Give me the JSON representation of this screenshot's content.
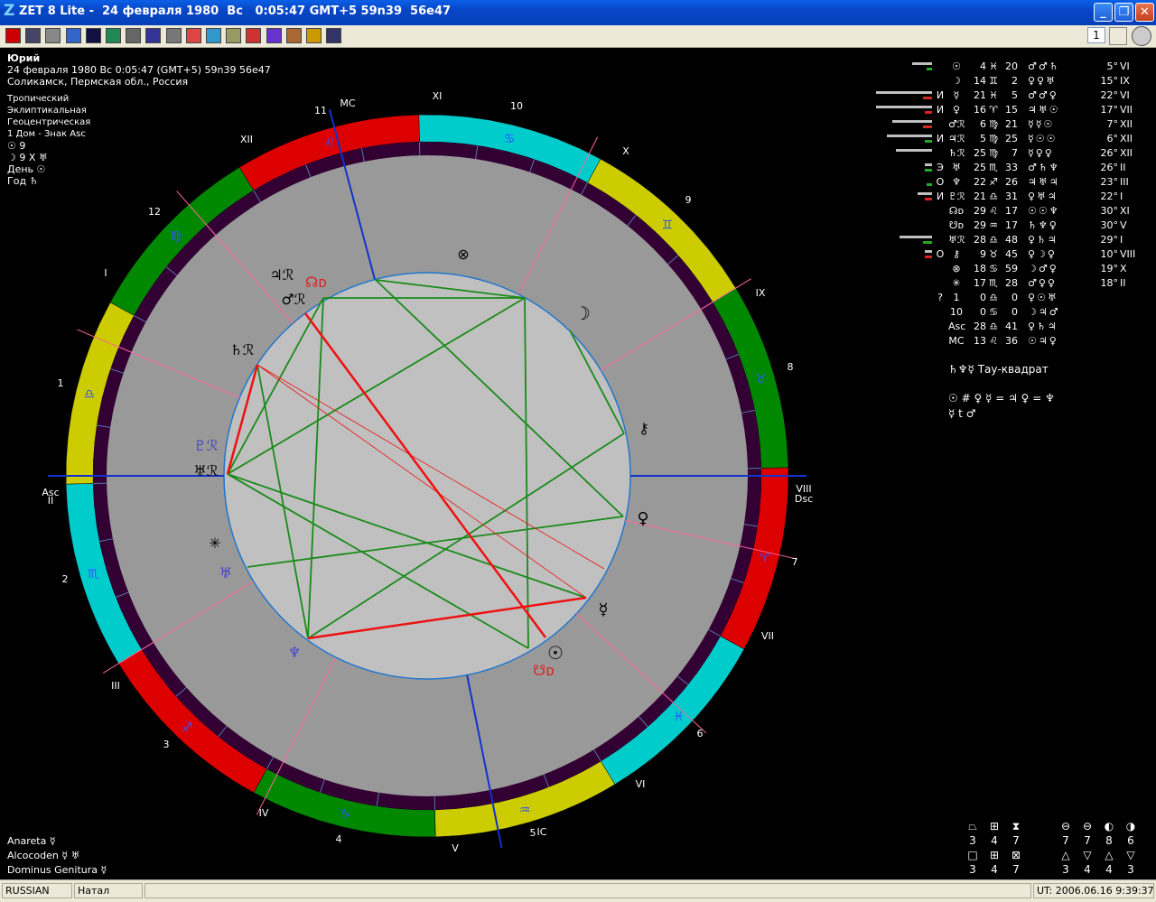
{
  "window": {
    "logo": "Z",
    "title": "ZET 8 Lite -  24 февраля 1980  Вс   0:05:47 GMT+5 59n39  56e47",
    "minimize": "_",
    "maximize": "❐",
    "close": "✕"
  },
  "toolbar": {
    "icons": [
      "sun-icon",
      "table-icon",
      "globe-icon",
      "wheel-icon",
      "star-map-icon",
      "grid-icon",
      "document-icon",
      "bookmark-icon",
      "page-icon",
      "color-grid-icon",
      "edit-icon",
      "notes-icon",
      "chart-icon",
      "wheel2-icon",
      "tools-icon",
      "person-icon",
      "graph-icon"
    ],
    "counter": "1"
  },
  "info": {
    "person": "Юрий",
    "date": "24 февраля 1980  Вс   0:05:47 (GMT+5) 59n39  56e47",
    "place": "Соликамск, Пермская обл., Россия",
    "zodiac": "Тропический",
    "coords": "Эклиптикальная",
    "center": "Геоцентрическая",
    "houses": "1 Дом - Знак Asc",
    "sun_line": "☉   9",
    "moon_line": "☽   9 X ♅",
    "day_line": "День ☉",
    "year_line": "Год ♄"
  },
  "positions": [
    {
      "flag": "",
      "glyph": "☉",
      "deg": "4",
      "sign": "♓",
      "min": "20",
      "rulers": "♂♂♄",
      "hdeg": "5°",
      "house": "VI",
      "gbar": 22,
      "cbar": 6,
      "ccol": "#22aa22"
    },
    {
      "flag": "",
      "glyph": "☽",
      "deg": "14",
      "sign": "♊",
      "min": "2",
      "rulers": "♀♀♅",
      "hdeg": "15°",
      "house": "IX",
      "gbar": 0,
      "cbar": 0,
      "ccol": "#22aa22"
    },
    {
      "flag": "И",
      "glyph": "☿",
      "deg": "21",
      "sign": "♓",
      "min": "5",
      "rulers": "♂♂♀",
      "hdeg": "22°",
      "house": "VI",
      "gbar": 62,
      "cbar": 10,
      "ccol": "#dd2222"
    },
    {
      "flag": "И",
      "glyph": "♀",
      "deg": "16",
      "sign": "♈",
      "min": "15",
      "rulers": "♃♅☉",
      "hdeg": "17°",
      "house": "VII",
      "gbar": 62,
      "cbar": 8,
      "ccol": "#dd2222"
    },
    {
      "flag": "",
      "glyph": "♂ℛ",
      "deg": "6",
      "sign": "♍",
      "min": "21",
      "rulers": "☿☿☉",
      "hdeg": "7°",
      "house": "XII",
      "gbar": 44,
      "cbar": 10,
      "ccol": "#dd2222"
    },
    {
      "flag": "И",
      "glyph": "♃ℛ",
      "deg": "5",
      "sign": "♍",
      "min": "25",
      "rulers": "☿☉☉",
      "hdeg": "6°",
      "house": "XII",
      "gbar": 50,
      "cbar": 8,
      "ccol": "#22aa22"
    },
    {
      "flag": "",
      "glyph": "♄ℛ",
      "deg": "25",
      "sign": "♍",
      "min": "7",
      "rulers": "☿♀♀",
      "hdeg": "26°",
      "house": "XII",
      "gbar": 40,
      "cbar": 0,
      "ccol": "#22aa22"
    },
    {
      "flag": "Э",
      "glyph": "♅",
      "deg": "25",
      "sign": "♏",
      "min": "33",
      "rulers": "♂♄♆",
      "hdeg": "26°",
      "house": "II",
      "gbar": 8,
      "cbar": 8,
      "ccol": "#22aa22"
    },
    {
      "flag": "О",
      "glyph": "♆",
      "deg": "22",
      "sign": "♐",
      "min": "26",
      "rulers": "♃♅♃",
      "hdeg": "23°",
      "house": "III",
      "gbar": 0,
      "cbar": 6,
      "ccol": "#22aa22"
    },
    {
      "flag": "И",
      "glyph": "♇ℛ",
      "deg": "21",
      "sign": "♎",
      "min": "31",
      "rulers": "♀♅♃",
      "hdeg": "22°",
      "house": "I",
      "gbar": 16,
      "cbar": 8,
      "ccol": "#dd2222"
    },
    {
      "flag": "",
      "glyph": "☊ᴅ",
      "deg": "29",
      "sign": "♌",
      "min": "17",
      "rulers": "☉☉♆",
      "hdeg": "30°",
      "house": "XI",
      "gbar": 0,
      "cbar": 0,
      "ccol": "#22aa22"
    },
    {
      "flag": "",
      "glyph": "☋ᴅ",
      "deg": "29",
      "sign": "♒",
      "min": "17",
      "rulers": "♄♆♀",
      "hdeg": "30°",
      "house": "V",
      "gbar": 0,
      "cbar": 0,
      "ccol": "#22aa22"
    },
    {
      "flag": "",
      "glyph": "♅ℛ",
      "deg": "28",
      "sign": "♎",
      "min": "48",
      "rulers": "♀♄♃",
      "hdeg": "29°",
      "house": "I",
      "gbar": 36,
      "cbar": 10,
      "ccol": "#22aa22"
    },
    {
      "flag": "О",
      "glyph": "⚷",
      "deg": "9",
      "sign": "♉",
      "min": "45",
      "rulers": "♀☽♀",
      "hdeg": "10°",
      "house": "VIII",
      "gbar": 8,
      "cbar": 8,
      "ccol": "#dd2222"
    },
    {
      "flag": "",
      "glyph": "⊗",
      "deg": "18",
      "sign": "♋",
      "min": "59",
      "rulers": "☽♂♀",
      "hdeg": "19°",
      "house": "X",
      "gbar": 0,
      "cbar": 0,
      "ccol": "#22aa22"
    },
    {
      "flag": "",
      "glyph": "✳",
      "deg": "17",
      "sign": "♏",
      "min": "28",
      "rulers": "♂♀♀",
      "hdeg": "18°",
      "house": "II",
      "gbar": 0,
      "cbar": 0,
      "ccol": "#22aa22"
    },
    {
      "flag": "?",
      "glyph": "1",
      "deg": "0",
      "sign": "♎",
      "min": "0",
      "rulers": "♀☉♅",
      "hdeg": "",
      "house": "",
      "gbar": 0,
      "cbar": 0,
      "ccol": "#22aa22"
    },
    {
      "flag": "",
      "glyph": "10",
      "deg": "0",
      "sign": "♋",
      "min": "0",
      "rulers": "☽♃♂",
      "hdeg": "",
      "house": "",
      "gbar": 0,
      "cbar": 0,
      "ccol": "#22aa22"
    },
    {
      "flag": "",
      "glyph": "Asc",
      "deg": "28",
      "sign": "♎",
      "min": "41",
      "rulers": "♀♄♃",
      "hdeg": "",
      "house": "",
      "gbar": 0,
      "cbar": 0,
      "ccol": "#22aa22"
    },
    {
      "flag": "",
      "glyph": "MC",
      "deg": "13",
      "sign": "♌",
      "min": "36",
      "rulers": "☉♃♀",
      "hdeg": "",
      "house": "",
      "gbar": 0,
      "cbar": 0,
      "ccol": "#22aa22"
    }
  ],
  "tau_square": "♄♆☿  Тау-квадрат",
  "aspects_line1": "☉ # ♀  ☿ = ♃  ♀ = ♆",
  "aspects_line2": "☿ t ♂",
  "bottom_left": {
    "anareta": "Anareta  ☿",
    "alcocoden": "Alcocoden  ☿ ♅",
    "dominus": "Dominus Genitura   ☿"
  },
  "stats": {
    "left_icons": [
      "trapezoid-icon",
      "cross-icon",
      "hourglass-icon",
      "square-icon",
      "grid-square-icon",
      "cross-square-icon"
    ],
    "left_values": [
      "3",
      "4",
      "7",
      "3",
      "4",
      "7"
    ],
    "right_icons": [
      "circle-h-icon",
      "circle-m-icon",
      "circle-v-icon",
      "circle-half-icon",
      "triangle-up-icon",
      "triangle-down-icon",
      "triangle-up2-icon",
      "triangle-down2-icon"
    ],
    "right_values": [
      "7",
      "7",
      "8",
      "6",
      "3",
      "4",
      "4",
      "3"
    ]
  },
  "chart_wheel": {
    "house_numerals_outer": [
      "MC",
      "XI",
      "X",
      "IX",
      "VIII",
      "VII",
      "VI",
      "V",
      "IC",
      "IV",
      "III",
      "II",
      "I",
      "XII"
    ],
    "house_numbers": [
      "11",
      "10",
      "9",
      "8",
      "7",
      "6",
      "5",
      "4",
      "3",
      "2",
      "1",
      "12"
    ],
    "asc_label": "Asc",
    "dsc_label": "Dsc",
    "sign_colors": [
      "#dd0000",
      "#00cccc",
      "#cccc00",
      "#008800"
    ],
    "planet_labels": {
      "sun": "☉",
      "moon": "☽",
      "mercury": "☿",
      "venus": "♀",
      "mars": "♂ℛ",
      "jupiter": "♃ℛ",
      "saturn": "♄ℛ",
      "uranus": "♅",
      "neptune": "♆",
      "pluto": "♇ℛ",
      "node_n": "☊ᴅ",
      "node_s": "☋ᴅ",
      "chiron": "⚷",
      "lilith": "♅ℛ",
      "fortune": "⊗",
      "vertex": "✳"
    }
  },
  "status": {
    "language": "RUSSIAN",
    "mode": "Натал",
    "ut": "UT: 2006.06.16  9:39:37"
  }
}
